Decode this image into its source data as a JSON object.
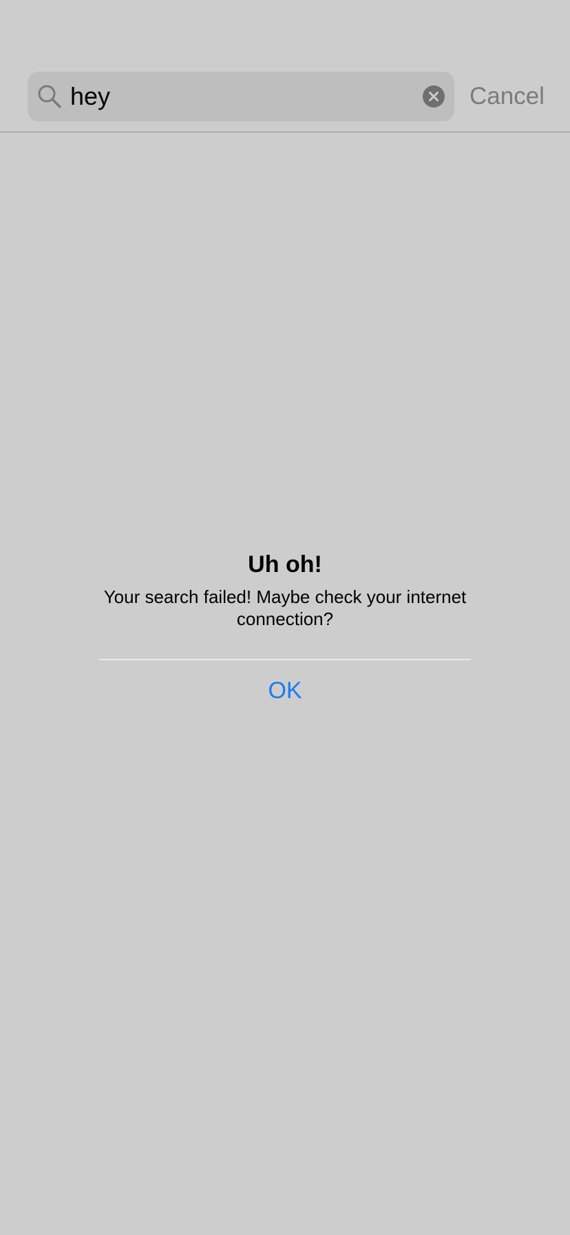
{
  "search": {
    "value": "hey",
    "icon": "search-icon",
    "clear_icon": "clear-icon",
    "cancel_label": "Cancel"
  },
  "alert": {
    "title": "Uh oh!",
    "message": "Your search failed! Maybe check your internet connection?",
    "ok_label": "OK"
  },
  "colors": {
    "background": "#cdcdcd",
    "search_field": "#bebebe",
    "accent": "#1a7cf0",
    "cancel_text": "#7b7b7b"
  }
}
